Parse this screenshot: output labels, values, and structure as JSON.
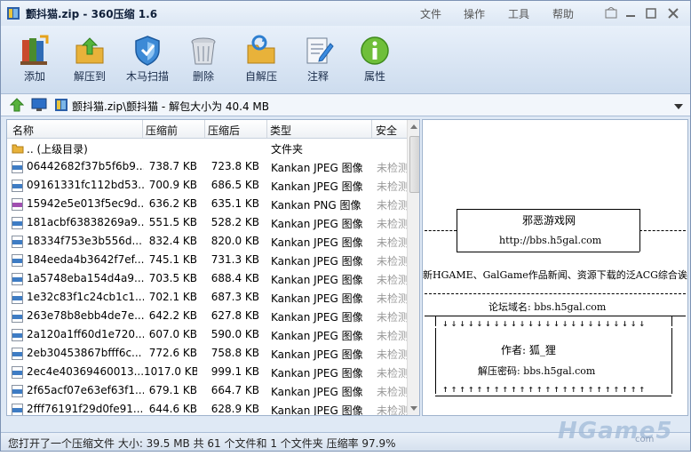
{
  "window": {
    "title": "颤抖猫.zip - 360压缩 1.6",
    "menu": [
      "文件",
      "操作",
      "工具",
      "帮助"
    ]
  },
  "toolbar": {
    "items": [
      {
        "label": "添加",
        "icon": "add-books-icon"
      },
      {
        "label": "解压到",
        "icon": "extract-folder-icon"
      },
      {
        "label": "木马扫描",
        "icon": "shield-icon"
      },
      {
        "label": "删除",
        "icon": "trash-icon"
      },
      {
        "label": "自解压",
        "icon": "self-extract-icon"
      },
      {
        "label": "注释",
        "icon": "notepad-icon"
      },
      {
        "label": "属性",
        "icon": "info-icon"
      }
    ]
  },
  "address": {
    "path": "颤抖猫.zip\\颤抖猫 - 解包大小为 40.4 MB"
  },
  "filelist": {
    "columns": [
      "名称",
      "压缩前",
      "压缩后",
      "类型",
      "安全"
    ],
    "rows": [
      {
        "name": ".. (上级目录)",
        "before": "",
        "after": "",
        "type": "文件夹",
        "safety": "",
        "kind": "folder"
      },
      {
        "name": "06442682f37b5f6b9...",
        "before": "738.7 KB",
        "after": "723.8 KB",
        "type": "Kankan JPEG 图像",
        "safety": "未检测",
        "kind": "jpg"
      },
      {
        "name": "09161331fc112bd53...",
        "before": "700.9 KB",
        "after": "686.5 KB",
        "type": "Kankan JPEG 图像",
        "safety": "未检测",
        "kind": "jpg"
      },
      {
        "name": "15942e5e013f5ec9d...",
        "before": "636.2 KB",
        "after": "635.1 KB",
        "type": "Kankan PNG 图像",
        "safety": "未检测",
        "kind": "png"
      },
      {
        "name": "181acbf63838269a9...",
        "before": "551.5 KB",
        "after": "528.2 KB",
        "type": "Kankan JPEG 图像",
        "safety": "未检测",
        "kind": "jpg"
      },
      {
        "name": "18334f753e3b556d...",
        "before": "832.4 KB",
        "after": "820.0 KB",
        "type": "Kankan JPEG 图像",
        "safety": "未检测",
        "kind": "jpg"
      },
      {
        "name": "184eeda4b3642f7ef...",
        "before": "745.1 KB",
        "after": "731.3 KB",
        "type": "Kankan JPEG 图像",
        "safety": "未检测",
        "kind": "jpg"
      },
      {
        "name": "1a5748eba154d4a9...",
        "before": "703.5 KB",
        "after": "688.4 KB",
        "type": "Kankan JPEG 图像",
        "safety": "未检测",
        "kind": "jpg"
      },
      {
        "name": "1e32c83f1c24cb1c1...",
        "before": "702.1 KB",
        "after": "687.3 KB",
        "type": "Kankan JPEG 图像",
        "safety": "未检测",
        "kind": "jpg"
      },
      {
        "name": "263e78b8ebb4de7e...",
        "before": "642.2 KB",
        "after": "627.8 KB",
        "type": "Kankan JPEG 图像",
        "safety": "未检测",
        "kind": "jpg"
      },
      {
        "name": "2a120a1ff60d1e720...",
        "before": "607.0 KB",
        "after": "590.0 KB",
        "type": "Kankan JPEG 图像",
        "safety": "未检测",
        "kind": "jpg"
      },
      {
        "name": "2eb30453867bfff6c...",
        "before": "772.6 KB",
        "after": "758.8 KB",
        "type": "Kankan JPEG 图像",
        "safety": "未检测",
        "kind": "jpg"
      },
      {
        "name": "2ec4e40369460013...",
        "before": "1017.0 KB",
        "after": "999.1 KB",
        "type": "Kankan JPEG 图像",
        "safety": "未检测",
        "kind": "jpg"
      },
      {
        "name": "2f65acf07e63ef63f1...",
        "before": "679.1 KB",
        "after": "664.7 KB",
        "type": "Kankan JPEG 图像",
        "safety": "未检测",
        "kind": "jpg"
      },
      {
        "name": "2fff76191f29d0fe91...",
        "before": "644.6 KB",
        "after": "628.9 KB",
        "type": "Kankan JPEG 图像",
        "safety": "未检测",
        "kind": "jpg"
      }
    ]
  },
  "preview": {
    "site_name": "邪恶游戏网",
    "site_url": "http://bbs.h5gal.com",
    "slogan": "新HGAME、GalGame作品新闻、资源下载的泛ACG综合诶",
    "forum_label": "论坛域名:  bbs.h5gal.com",
    "author_label": "作者:    狐_狸",
    "password_label": "解压密码: bbs.h5gal.com",
    "arrows_down": "↓↓↓↓↓↓↓↓↓↓↓↓↓↓↓↓↓↓↓↓↓↓↓↓",
    "arrows_up": "↑↑↑↑↑↑↑↑↑↑↑↑↑↑↑↑↑↑↑↑↑↑↑↑"
  },
  "status": {
    "text": "您打开了一个压缩文件 大小: 39.5 MB 共 61 个文件和 1 个文件夹 压缩率 97.9%"
  },
  "watermark": {
    "text": "HGame5",
    "sub": "com"
  }
}
